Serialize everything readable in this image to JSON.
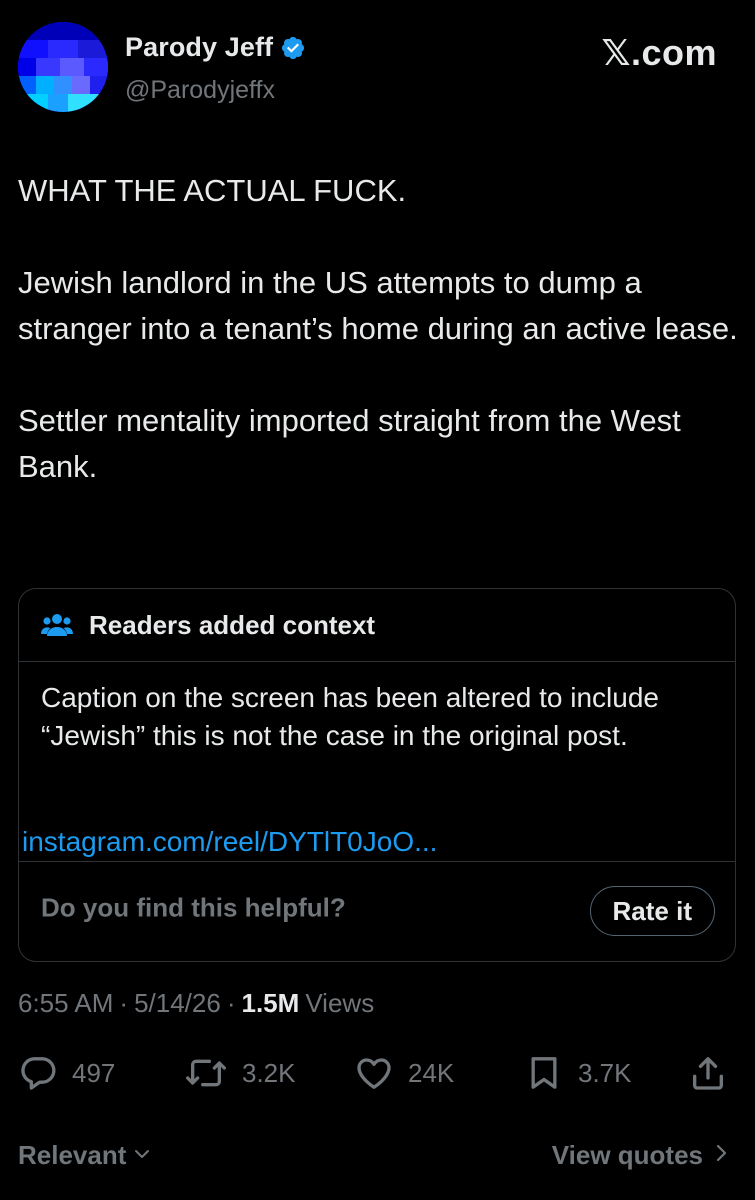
{
  "author": {
    "display_name": "Parody Jeff",
    "handle": "@Parodyjeffx",
    "verified_icon": "verified-badge-icon",
    "verified_color": "#1d9bf0"
  },
  "site_brand": "𝕏.com",
  "tweet": {
    "paragraphs": [
      "WHAT THE ACTUAL FUCK.",
      "Jewish landlord in the US attempts to dump a stranger into a tenant’s home during an active lease.",
      "Settler mentality imported straight from the West Bank."
    ]
  },
  "community_note": {
    "icon": "people-group-icon",
    "title": "Readers added context",
    "text": "Caption on the screen has been altered to include “Jewish” this is not the case in the original post.",
    "link": "instagram.com/reel/DYTlT0JoO...",
    "helpful_question": "Do you find this helpful?",
    "rate_button": "Rate it"
  },
  "meta": {
    "time": "6:55 AM",
    "separator": "·",
    "date": "5/14/26",
    "views_count": "1.5M",
    "views_label": "Views"
  },
  "actions": {
    "replies": "497",
    "reposts": "3.2K",
    "likes": "24K",
    "bookmarks": "3.7K"
  },
  "bottom": {
    "sort_label": "Relevant",
    "view_quotes": "View quotes"
  },
  "colors": {
    "background": "#000000",
    "text": "#e7e9ea",
    "muted": "#71767b",
    "accent": "#1d9bf0",
    "border": "#2f3336"
  }
}
